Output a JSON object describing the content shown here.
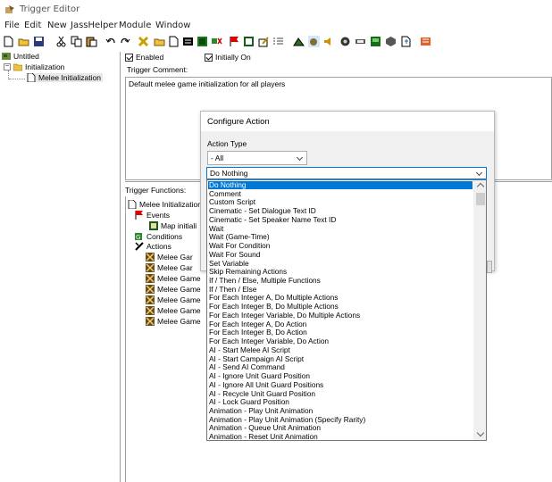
{
  "window": {
    "title": "Trigger Editor"
  },
  "menu": [
    "File",
    "Edit",
    "New",
    "JassHelper",
    "Module",
    "Window"
  ],
  "tree": {
    "root": "Untitled",
    "category": "Initialization",
    "trigger": "Melee Initialization"
  },
  "trigger": {
    "enabled_label": "Enabled",
    "initially_on_label": "Initially On",
    "comment_label": "Trigger Comment:",
    "comment_text": "Default melee game initialization for all players",
    "functions_label": "Trigger Functions:"
  },
  "functions": {
    "root": "Melee Initialization",
    "events": "Events",
    "event_item": "Map initiali",
    "conditions": "Conditions",
    "actions": "Actions",
    "action_items": [
      "Melee Gar",
      "Melee Gar",
      "Melee Game",
      "Melee Game",
      "Melee Game",
      "Melee Game",
      "Melee Game"
    ]
  },
  "dialog": {
    "title": "Configure Action",
    "action_type_label": "Action Type",
    "action_type_value": "- All",
    "selected_action": "Do Nothing",
    "options": [
      "Do Nothing",
      "Comment",
      "Custom Script",
      "Cinematic - Set Dialogue Text ID",
      "Cinematic - Set Speaker Name Text ID",
      "Wait",
      "Wait (Game-Time)",
      "Wait For Condition",
      "Wait For Sound",
      "Set Variable",
      "Skip Remaining Actions",
      "If / Then / Else, Multiple Functions",
      "If / Then / Else",
      "For Each Integer A, Do Multiple Actions",
      "For Each Integer B, Do Multiple Actions",
      "For Each Integer Variable, Do Multiple Actions",
      "For Each Integer A, Do Action",
      "For Each Integer B, Do Action",
      "For Each Integer Variable, Do Action",
      "AI - Start Melee AI Script",
      "AI - Start Campaign AI Script",
      "AI - Send AI Command",
      "AI - Ignore Unit Guard Position",
      "AI - Ignore All Unit Guard Positions",
      "AI - Recycle Unit Guard Position",
      "AI - Lock Guard Position",
      "Animation - Play Unit Animation",
      "Animation - Play Unit Animation (Specify Rarity)",
      "Animation - Queue Unit Animation",
      "Animation - Reset Unit Animation"
    ]
  },
  "colors": {
    "selection": "#0078d7",
    "border": "#a0a0a0",
    "dialog_bg": "#f0f0f0"
  }
}
